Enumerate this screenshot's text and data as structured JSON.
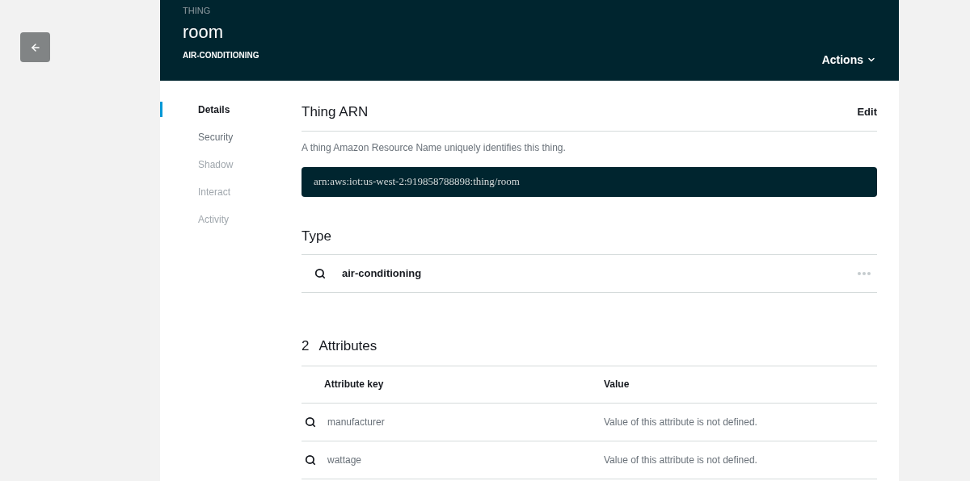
{
  "header": {
    "eyebrow": "THING",
    "title": "room",
    "subtitle": "AIR-CONDITIONING",
    "actions_button": "Actions"
  },
  "nav": [
    {
      "label": "Details",
      "selected": true,
      "disabled": false
    },
    {
      "label": "Security",
      "selected": false,
      "disabled": false
    },
    {
      "label": "Shadow",
      "selected": false,
      "disabled": true
    },
    {
      "label": "Interact",
      "selected": false,
      "disabled": true
    },
    {
      "label": "Activity",
      "selected": false,
      "disabled": true
    }
  ],
  "arn": {
    "heading": "Thing ARN",
    "edit_button": "Edit",
    "description": "A thing Amazon Resource Name uniquely identifies this thing.",
    "value": "arn:aws:iot:us-west-2:919858788898:thing/room"
  },
  "type": {
    "heading": "Type",
    "name": "air-conditioning"
  },
  "attributes": {
    "count": "2",
    "heading": "Attributes",
    "columns": [
      "Attribute key",
      "Value"
    ],
    "rows": [
      {
        "key": "manufacturer",
        "value": "Value of this attribute is not defined."
      },
      {
        "key": "wattage",
        "value": "Value of this attribute is not defined."
      }
    ]
  }
}
